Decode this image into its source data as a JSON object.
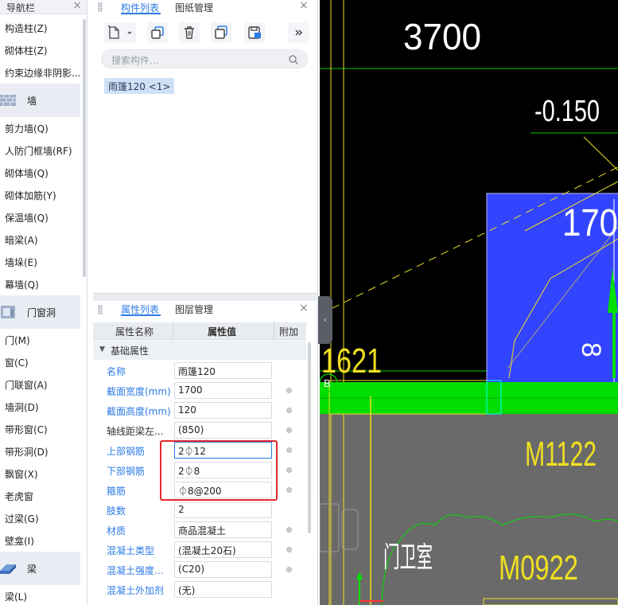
{
  "nav": {
    "title": "导航栏",
    "items_top": [
      "构造柱(Z)",
      "砌体柱(Z)",
      "约束边缘非阴影..."
    ],
    "cat_wall": "墙",
    "items_wall": [
      "剪力墙(Q)",
      "人防门框墙(RF)",
      "砌体墙(Q)",
      "砌体加筋(Y)",
      "保温墙(Q)",
      "暗梁(A)",
      "墙垛(E)",
      "幕墙(Q)"
    ],
    "cat_door": "门窗洞",
    "items_door": [
      "门(M)",
      "窗(C)",
      "门联窗(A)",
      "墙洞(D)",
      "带形窗(C)",
      "带形洞(D)",
      "飘窗(X)",
      "老虎窗",
      "过梁(G)",
      "壁龛(I)"
    ],
    "cat_beam": "梁",
    "items_beam": [
      "梁(L)"
    ]
  },
  "components": {
    "tab_list": "构件列表",
    "tab_drawing": "图纸管理",
    "search_placeholder": "搜索构件...",
    "item": "雨篷120 <1>"
  },
  "properties": {
    "tab_props": "属性列表",
    "tab_layers": "图层管理",
    "col_name": "属性名称",
    "col_value": "属性值",
    "col_extra": "附加",
    "group": "基础属性",
    "rows": [
      {
        "name": "名称",
        "value": "雨篷120"
      },
      {
        "name": "截面宽度(mm)",
        "value": "1700"
      },
      {
        "name": "截面高度(mm)",
        "value": "120"
      },
      {
        "name": "轴线距梁左...",
        "value": "(850)"
      },
      {
        "name": "上部钢筋",
        "value": "2⏀12"
      },
      {
        "name": "下部钢筋",
        "value": "2⏀8"
      },
      {
        "name": "箍筋",
        "value": "⏀8@200"
      },
      {
        "name": "肢数",
        "value": "2"
      },
      {
        "name": "材质",
        "value": "商品混凝土"
      },
      {
        "name": "混凝土类型",
        "value": "(混凝土20石)"
      },
      {
        "name": "混凝土强度...",
        "value": "(C20)"
      },
      {
        "name": "混凝土外加剂",
        "value": "(无)"
      }
    ]
  },
  "canvas": {
    "dim_top": "3700",
    "elevation": "-0.150",
    "dim_blue": "170",
    "dim_vert": "8",
    "dim_left": "1621",
    "axis_b": "B",
    "door_m1122": "M1122",
    "door_m0922": "M0922",
    "room": "门卫室"
  },
  "colors": {
    "accent": "#2c7be5",
    "highlight": "#e3262e",
    "cad_green": "#00e000",
    "cad_blue": "#3344ff",
    "cad_yellow": "#f0e020",
    "cad_gray": "#6a6a6a"
  }
}
